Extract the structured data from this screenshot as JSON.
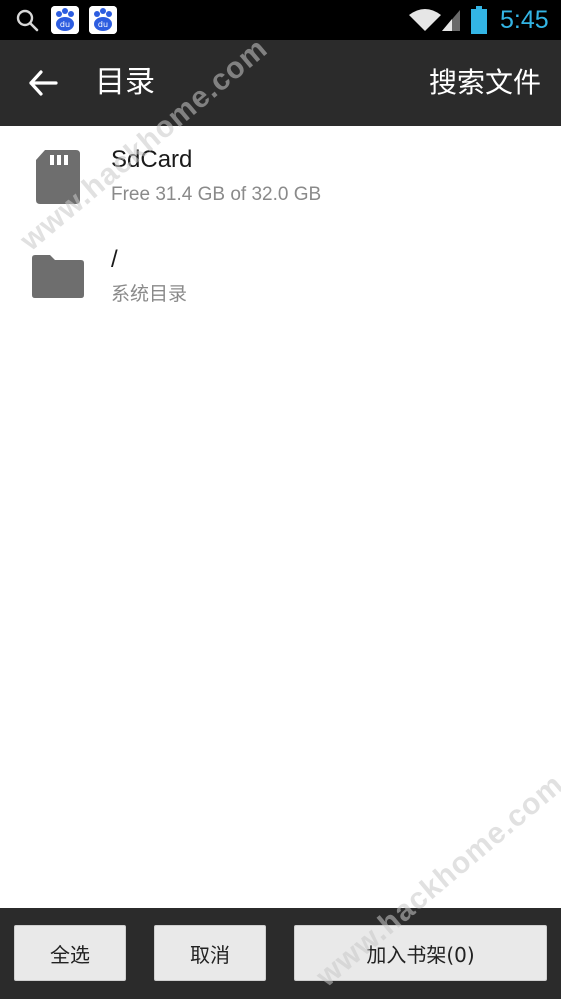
{
  "status_bar": {
    "time": "5:45",
    "icons": [
      "search-icon",
      "baidu-icon",
      "baidu-icon",
      "wifi-icon",
      "signal-icon",
      "battery-icon"
    ],
    "time_color": "#33b5e5"
  },
  "action_bar": {
    "title": "目录",
    "action_label": "搜索文件",
    "back_icon": "arrow-left-icon",
    "background": "#2b2b2b"
  },
  "files": [
    {
      "name": "SdCard",
      "subtitle": "Free 31.4 GB of 32.0 GB",
      "icon": "sd-card-icon"
    },
    {
      "name": "/",
      "subtitle": "系统目录",
      "icon": "folder-icon"
    }
  ],
  "bottom_bar": {
    "select_all_label": "全选",
    "cancel_label": "取消",
    "add_to_shelf_label": "加入书架(0)"
  },
  "watermark": {
    "text": "www.hackhome.com"
  }
}
